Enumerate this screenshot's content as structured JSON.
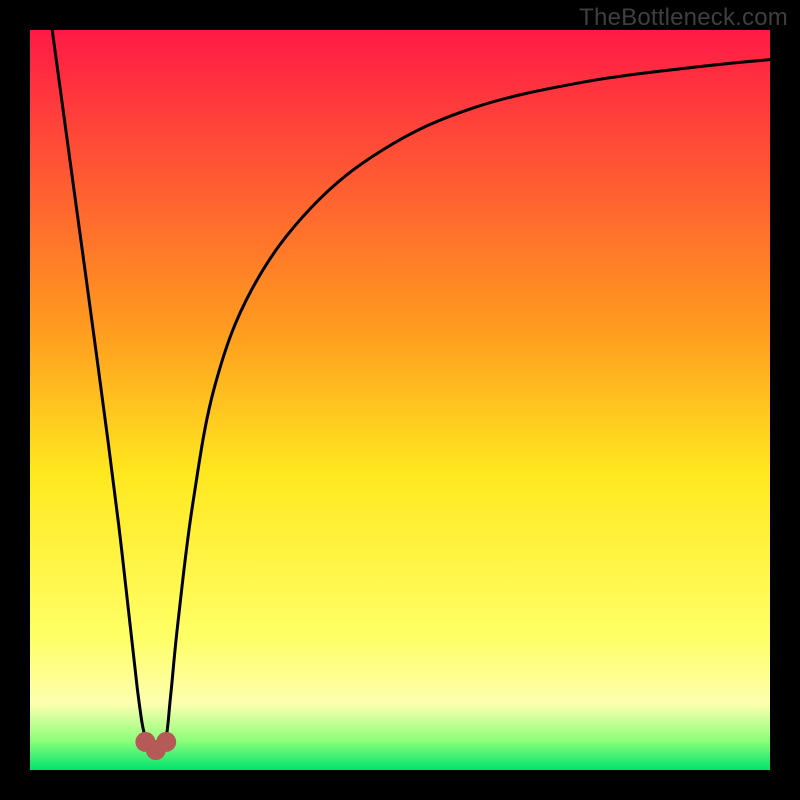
{
  "watermark": "TheBottleneck.com",
  "chart_data": {
    "type": "line",
    "title": "",
    "xlabel": "",
    "ylabel": "",
    "xlim": [
      0,
      100
    ],
    "ylim": [
      0,
      100
    ],
    "grid": false,
    "legend": false,
    "gradient_bands": [
      {
        "y": 100,
        "color": "#ff1a46"
      },
      {
        "y": 60,
        "color": "#ff9a1f"
      },
      {
        "y": 40,
        "color": "#ffe81f"
      },
      {
        "y": 18,
        "color": "#ffff66"
      },
      {
        "y": 9,
        "color": "#fdffb0"
      },
      {
        "y": 4,
        "color": "#8eff7a"
      },
      {
        "y": 0,
        "color": "#00e36e"
      }
    ],
    "series": [
      {
        "name": "curve",
        "x": [
          3,
          6,
          9,
          12,
          14.5,
          15.7,
          17,
          18.3,
          19,
          20,
          22,
          25,
          30,
          38,
          48,
          60,
          75,
          90,
          100
        ],
        "y": [
          100,
          78,
          56,
          33,
          11,
          4,
          2.5,
          4,
          10,
          20,
          36,
          52,
          65,
          76,
          84,
          89.5,
          93,
          95,
          96
        ]
      }
    ],
    "markers": [
      {
        "name": "min-left",
        "x": 15.6,
        "y": 3.8
      },
      {
        "name": "min-center",
        "x": 17.0,
        "y": 2.7
      },
      {
        "name": "min-right",
        "x": 18.4,
        "y": 3.8
      }
    ]
  }
}
